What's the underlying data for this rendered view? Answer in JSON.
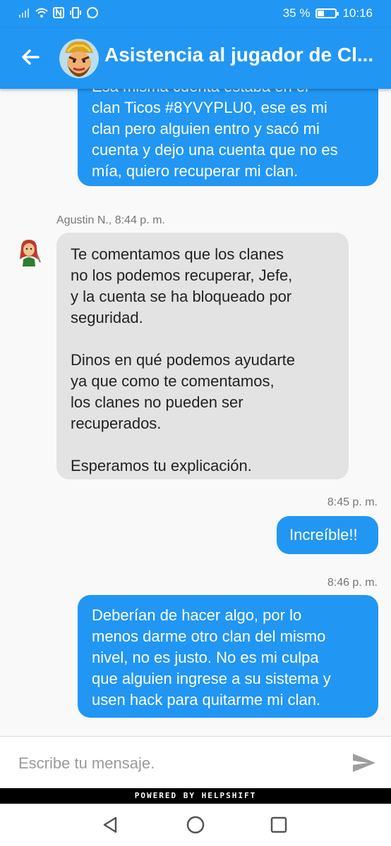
{
  "status_bar": {
    "battery_text": "35 %",
    "battery_level": 0.35,
    "time": "10:16",
    "icons": [
      "signal-icon",
      "wifi-icon",
      "nfc-icon",
      "vibrate-icon",
      "whatsapp-icon"
    ]
  },
  "app_bar": {
    "title": "Asistencia al jugador de Cl...",
    "back_icon": "arrow-left-icon",
    "avatar_icon": "clash-of-clans-avatar"
  },
  "messages": {
    "m1": {
      "side": "outgoing",
      "lines": [
        "Esa misma cuenta estaba en el",
        "clan Ticos #8YVYPLU0, ese es mi",
        "clan pero alguien entro y sacó mi",
        "cuenta y dejo una cuenta que no es",
        "mía, quiero recuperar mi clan."
      ]
    },
    "m2": {
      "side": "incoming",
      "sender_time": "Agustin N., 8:44 p. m.",
      "lines": [
        "Te comentamos que los clanes",
        "no los podemos recuperar, Jefe,",
        "y la cuenta se ha bloqueado por",
        "seguridad.",
        "",
        "Dinos en qué podemos ayudarte",
        "ya que como te comentamos,",
        "los clanes no pueden ser",
        "recuperados.",
        "",
        "Esperamos tu explicación."
      ]
    },
    "m3": {
      "side": "outgoing",
      "time": "8:45 p. m.",
      "text": "Increíble!!"
    },
    "m4": {
      "side": "outgoing",
      "time": "8:46 p. m.",
      "lines": [
        "Deberían de hacer algo, por lo",
        "menos darme otro clan del mismo",
        "nivel, no es justo. No es mi culpa",
        "que alguien ingrese a su sistema y",
        "usen hack para quitarme mi clan."
      ]
    }
  },
  "composer": {
    "placeholder": "Escribe tu mensaje.",
    "send_icon": "send-icon"
  },
  "powered_by": "POWERED BY HELPSHIFT",
  "nav_bar": {
    "icons": [
      "back-triangle-icon",
      "home-circle-icon",
      "recents-square-icon"
    ]
  },
  "colors": {
    "primary": "#2196f3",
    "incoming_bubble": "#e3e3e3",
    "background": "#f9f9f9"
  }
}
